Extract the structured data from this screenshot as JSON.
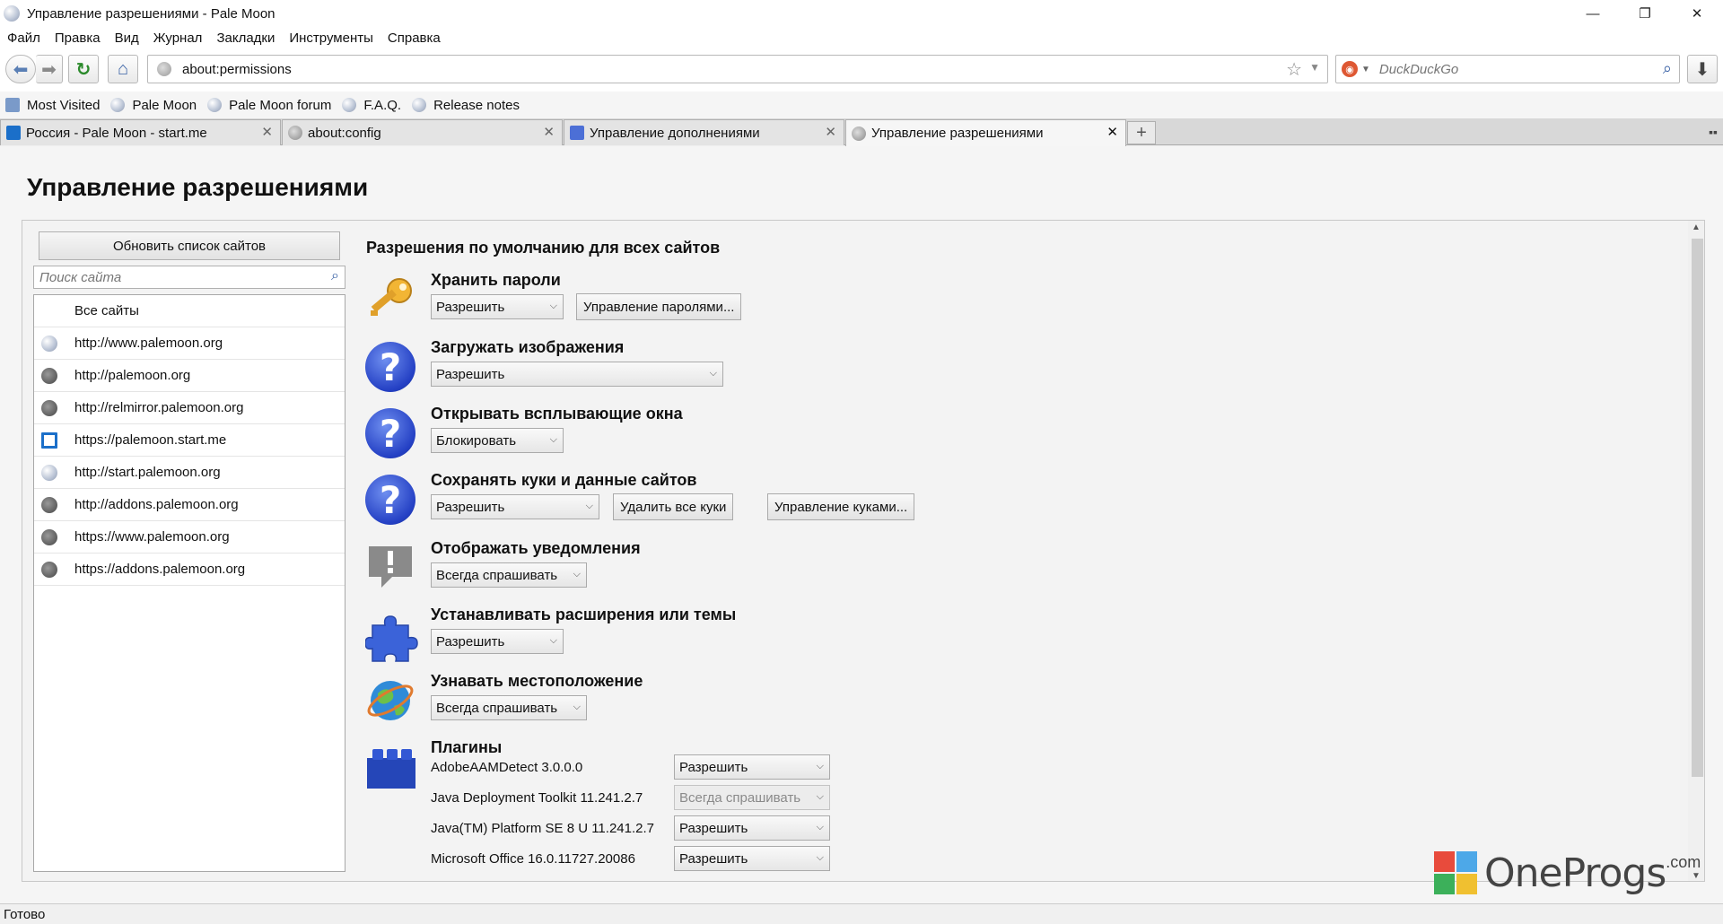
{
  "window": {
    "title": "Управление разрешениями - Pale Moon",
    "minimize": "—",
    "restore": "❐",
    "close": "✕"
  },
  "menu": [
    "Файл",
    "Правка",
    "Вид",
    "Журнал",
    "Закладки",
    "Инструменты",
    "Справка"
  ],
  "nav": {
    "url": "about:permissions",
    "search_placeholder": "DuckDuckGo"
  },
  "bookmarks": [
    "Most Visited",
    "Pale Moon",
    "Pale Moon forum",
    "F.A.Q.",
    "Release notes"
  ],
  "tabs": [
    {
      "label": "Россия - Pale Moon - start.me",
      "active": false
    },
    {
      "label": "about:config",
      "active": false
    },
    {
      "label": "Управление дополнениями",
      "active": false
    },
    {
      "label": "Управление разрешениями",
      "active": true
    }
  ],
  "page": {
    "title": "Управление разрешениями",
    "refresh_button": "Обновить список сайтов",
    "site_search_placeholder": "Поиск сайта",
    "all_sites": "Все сайты",
    "sites": [
      "http://www.palemoon.org",
      "http://palemoon.org",
      "http://relmirror.palemoon.org",
      "https://palemoon.start.me",
      "http://start.palemoon.org",
      "http://addons.palemoon.org",
      "https://www.palemoon.org",
      "https://addons.palemoon.org"
    ],
    "defaults_title": "Разрешения по умолчанию для всех сайтов",
    "permissions": {
      "passwords": {
        "title": "Хранить пароли",
        "value": "Разрешить",
        "button": "Управление паролями..."
      },
      "images": {
        "title": "Загружать изображения",
        "value": "Разрешить"
      },
      "popups": {
        "title": "Открывать всплывающие окна",
        "value": "Блокировать"
      },
      "cookies": {
        "title": "Сохранять куки и данные сайтов",
        "value": "Разрешить",
        "button_delete": "Удалить все куки",
        "button_manage": "Управление куками..."
      },
      "notifications": {
        "title": "Отображать уведомления",
        "value": "Всегда спрашивать"
      },
      "install": {
        "title": "Устанавливать расширения или темы",
        "value": "Разрешить"
      },
      "geo": {
        "title": "Узнавать местоположение",
        "value": "Всегда спрашивать"
      },
      "plugins": {
        "title": "Плагины",
        "items": [
          {
            "name": "AdobeAAMDetect 3.0.0.0",
            "value": "Разрешить"
          },
          {
            "name": "Java Deployment Toolkit 11.241.2.7",
            "value": "Всегда спрашивать"
          },
          {
            "name": "Java(TM) Platform SE 8 U 11.241.2.7",
            "value": "Разрешить"
          },
          {
            "name": "Microsoft Office 16.0.11727.20086",
            "value": "Разрешить"
          }
        ]
      }
    }
  },
  "watermark": {
    "text": "OneProgs",
    "suffix": ".com"
  },
  "status": "Готово"
}
